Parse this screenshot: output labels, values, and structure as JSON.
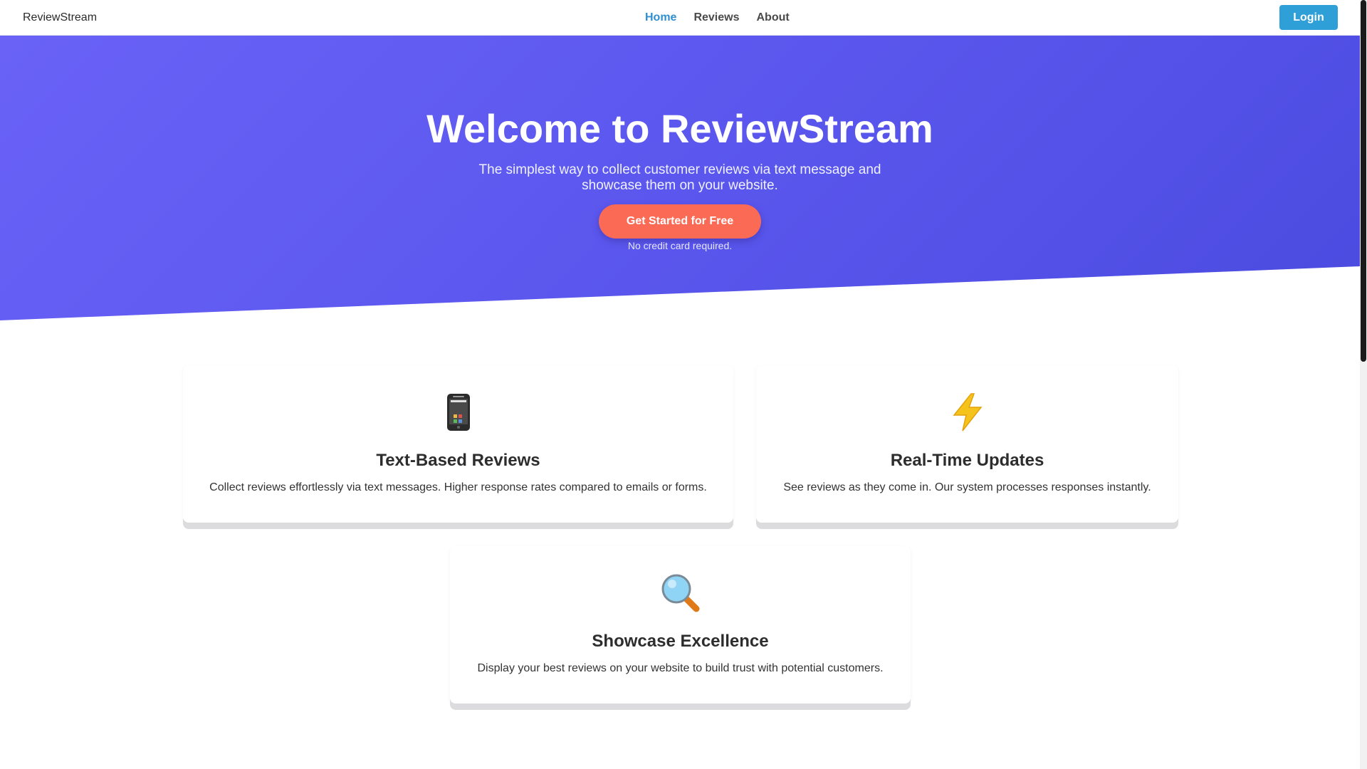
{
  "nav": {
    "brand": "ReviewStream",
    "links": [
      {
        "label": "Home",
        "active": true
      },
      {
        "label": "Reviews",
        "active": false
      },
      {
        "label": "About",
        "active": false
      }
    ],
    "login_label": "Login"
  },
  "hero": {
    "title": "Welcome to ReviewStream",
    "subtitle": "The simplest way to collect customer reviews via text message and showcase them on your website.",
    "cta_label": "Get Started for Free",
    "cta_note": "No credit card required."
  },
  "features": [
    {
      "icon": "mobile-phone-icon",
      "title": "Text-Based Reviews",
      "text": "Collect reviews effortlessly via text messages. Higher response rates compared to emails or forms."
    },
    {
      "icon": "lightning-bolt-icon",
      "title": "Real-Time Updates",
      "text": "See reviews as they come in. Our system processes responses instantly."
    },
    {
      "icon": "magnifying-glass-icon",
      "title": "Showcase Excellence",
      "text": "Display your best reviews on your website to build trust with potential customers."
    }
  ],
  "colors": {
    "hero_gradient_start": "#6a62f7",
    "hero_gradient_end": "#4b4be0",
    "cta": "#fb6a55",
    "login": "#2f9fd8",
    "nav_active": "#2f8fd1",
    "features_bg": "#f7f8fa"
  }
}
